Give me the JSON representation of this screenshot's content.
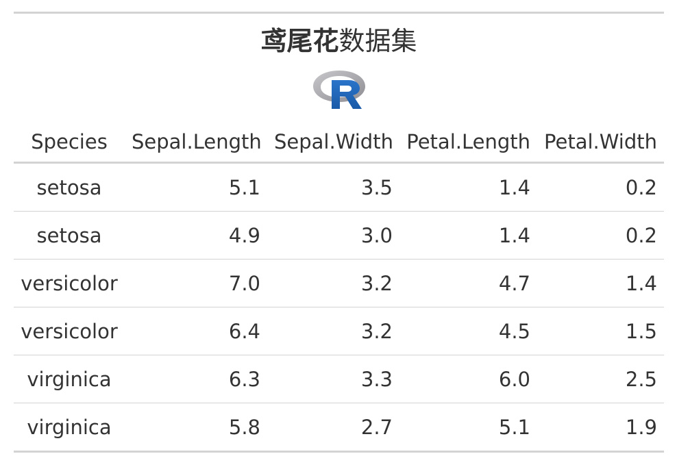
{
  "title": {
    "bold_part": "鸢尾花",
    "regular_part": "数据集"
  },
  "logo": {
    "letter": "R",
    "ring_color": "#9a9aa0",
    "letter_color": "#1f65b7"
  },
  "table": {
    "columns": [
      "Species",
      "Sepal.Length",
      "Sepal.Width",
      "Petal.Length",
      "Petal.Width"
    ],
    "rows": [
      [
        "setosa",
        "5.1",
        "3.5",
        "1.4",
        "0.2"
      ],
      [
        "setosa",
        "4.9",
        "3.0",
        "1.4",
        "0.2"
      ],
      [
        "versicolor",
        "7.0",
        "3.2",
        "4.7",
        "1.4"
      ],
      [
        "versicolor",
        "6.4",
        "3.2",
        "4.5",
        "1.5"
      ],
      [
        "virginica",
        "6.3",
        "3.3",
        "6.0",
        "2.5"
      ],
      [
        "virginica",
        "5.8",
        "2.7",
        "5.1",
        "1.9"
      ]
    ]
  }
}
